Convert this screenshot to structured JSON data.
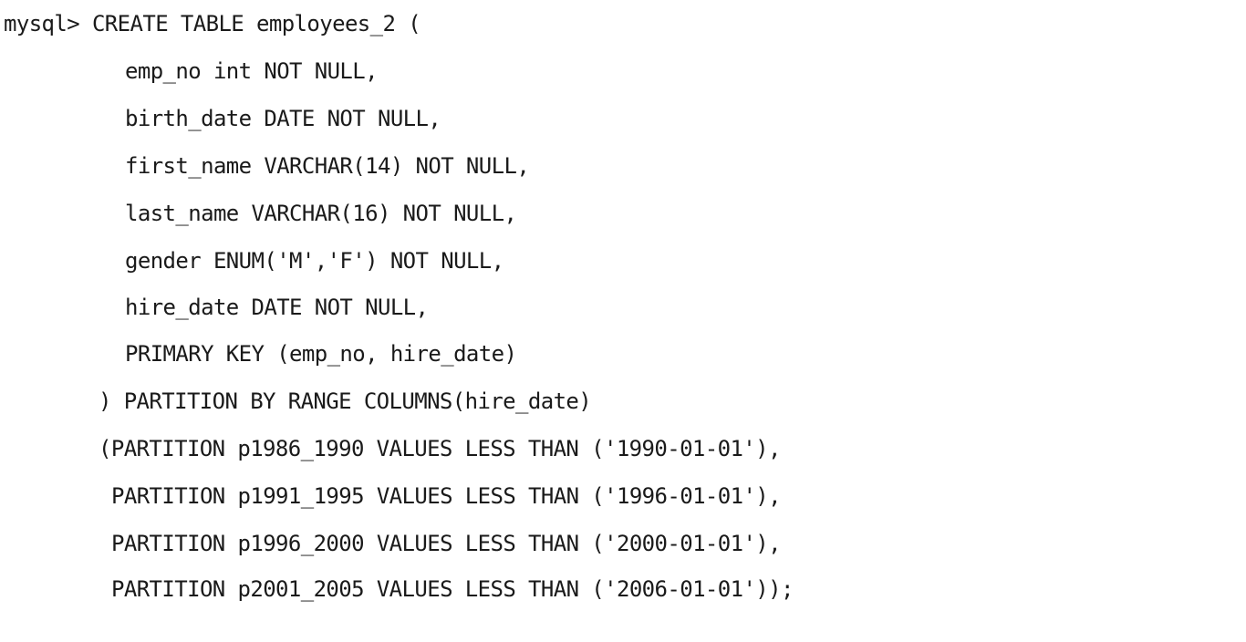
{
  "terminal": {
    "prompt": "mysql>",
    "lines": {
      "l0": " CREATE TABLE employees_2 (",
      "l1": "emp_no int NOT NULL,",
      "l2": "birth_date DATE NOT NULL,",
      "l3": "first_name VARCHAR(14) NOT NULL,",
      "l4": "last_name VARCHAR(16) NOT NULL,",
      "l5": "gender ENUM('M','F') NOT NULL,",
      "l6": "hire_date DATE NOT NULL,",
      "l7": "PRIMARY KEY (emp_no, hire_date)",
      "l8": ") PARTITION BY RANGE COLUMNS(hire_date)",
      "l9": "(PARTITION p1986_1990 VALUES LESS THAN ('1990-01-01'),",
      "l10": "PARTITION p1991_1995 VALUES LESS THAN ('1996-01-01'),",
      "l11": "PARTITION p1996_2000 VALUES LESS THAN ('2000-01-01'),",
      "l12": "PARTITION p2001_2005 VALUES LESS THAN ('2006-01-01'));"
    }
  }
}
